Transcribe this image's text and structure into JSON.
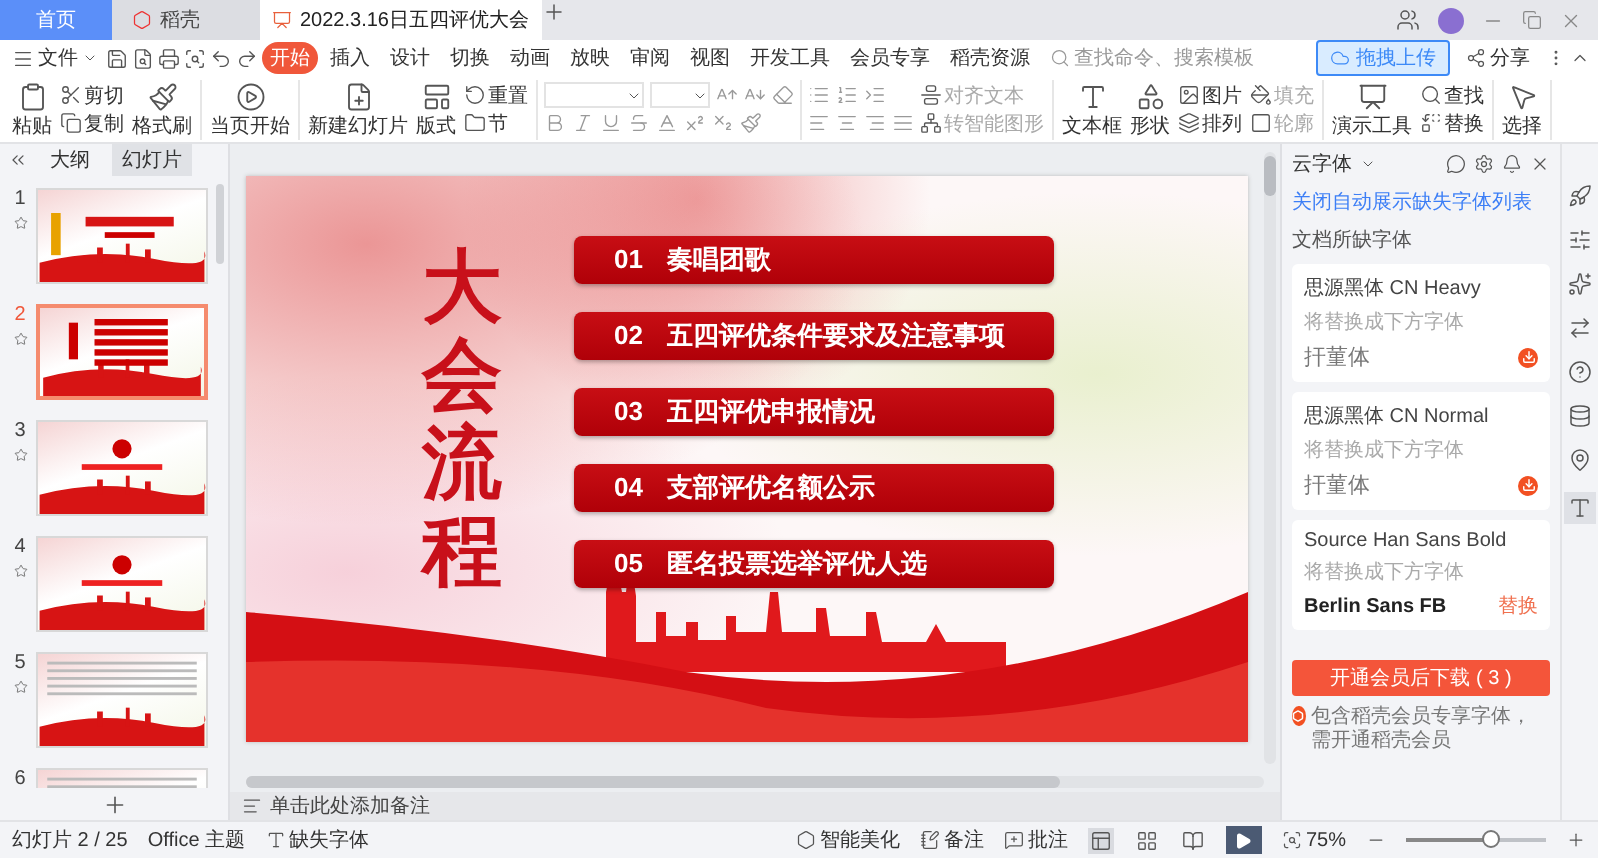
{
  "title_bar": {
    "tabs": [
      {
        "label": "首页",
        "kind": "home",
        "selected": false
      },
      {
        "label": "稻壳",
        "kind": "app",
        "selected": false
      },
      {
        "label": "2022.3.16日五四评优大会",
        "kind": "doc",
        "selected": true
      }
    ]
  },
  "menu": {
    "file": "文件",
    "tabs": [
      {
        "label": "开始",
        "selected": true
      },
      {
        "label": "插入",
        "selected": false
      },
      {
        "label": "设计",
        "selected": false
      },
      {
        "label": "切换",
        "selected": false
      },
      {
        "label": "动画",
        "selected": false
      },
      {
        "label": "放映",
        "selected": false
      },
      {
        "label": "审阅",
        "selected": false
      },
      {
        "label": "视图",
        "selected": false
      },
      {
        "label": "开发工具",
        "selected": false
      },
      {
        "label": "会员专享",
        "selected": false
      },
      {
        "label": "稻壳资源",
        "selected": false
      }
    ],
    "search": {
      "placeholder": "查找命令、搜索模板"
    },
    "upload_button": "拖拽上传",
    "share": "分享"
  },
  "toolbar": [
    {
      "columns": [
        {
          "kind": "large",
          "items": [
            {
              "label": "粘贴",
              "disabled": false
            }
          ]
        },
        {
          "kind": "stack",
          "items": [
            {
              "label": "剪切",
              "disabled": false
            },
            {
              "label": "复制",
              "disabled": false
            }
          ]
        },
        {
          "kind": "large",
          "items": [
            {
              "label": "格式刷",
              "disabled": false
            }
          ]
        }
      ]
    },
    {
      "columns": [
        {
          "kind": "large",
          "items": [
            {
              "label": "当页开始",
              "disabled": false
            }
          ]
        }
      ]
    },
    {
      "columns": [
        {
          "kind": "large",
          "items": [
            {
              "label": "新建幻灯片",
              "disabled": false
            }
          ]
        },
        {
          "kind": "large",
          "items": [
            {
              "label": "版式",
              "disabled": false
            }
          ]
        },
        {
          "kind": "stack",
          "items": [
            {
              "label": "重置",
              "disabled": false
            },
            {
              "label": "节",
              "disabled": false
            }
          ]
        }
      ]
    },
    {
      "columns": [
        {
          "kind": "font"
        }
      ]
    },
    {
      "columns": [
        {
          "kind": "paragraph"
        },
        {
          "kind": "stack",
          "items": [
            {
              "label": "对齐文本",
              "disabled": true
            },
            {
              "label": "转智能图形",
              "disabled": true
            }
          ]
        }
      ]
    },
    {
      "columns": [
        {
          "kind": "large",
          "items": [
            {
              "label": "文本框",
              "disabled": false
            }
          ]
        },
        {
          "kind": "large",
          "items": [
            {
              "label": "形状",
              "disabled": false
            }
          ]
        },
        {
          "kind": "stack",
          "items": [
            {
              "label": "图片",
              "disabled": false
            },
            {
              "label": "排列",
              "disabled": false
            }
          ]
        },
        {
          "kind": "stack",
          "items": [
            {
              "label": "填充",
              "disabled": true
            },
            {
              "label": "轮廓",
              "disabled": true
            }
          ]
        }
      ]
    },
    {
      "columns": [
        {
          "kind": "large",
          "items": [
            {
              "label": "演示工具",
              "disabled": false
            }
          ]
        },
        {
          "kind": "stack",
          "items": [
            {
              "label": "查找",
              "disabled": false
            },
            {
              "label": "替换",
              "disabled": false
            }
          ]
        }
      ]
    },
    {
      "columns": [
        {
          "kind": "large",
          "items": [
            {
              "label": "选择",
              "disabled": false
            }
          ]
        }
      ]
    }
  ],
  "left_panel": {
    "tabs": [
      {
        "label": "大纲",
        "selected": false
      },
      {
        "label": "幻灯片",
        "selected": true
      }
    ],
    "slides": [
      {
        "number": "1",
        "kind": "cover",
        "selected": false
      },
      {
        "number": "2",
        "kind": "agenda",
        "selected": true
      },
      {
        "number": "3",
        "kind": "section",
        "selected": false
      },
      {
        "number": "4",
        "kind": "section",
        "selected": false
      },
      {
        "number": "5",
        "kind": "text",
        "selected": false
      },
      {
        "number": "6",
        "kind": "text",
        "selected": false
      }
    ]
  },
  "slide": {
    "title": "大会流程",
    "items": [
      {
        "number": "01",
        "text": "奏唱团歌"
      },
      {
        "number": "02",
        "text": "五四评优条件要求及注意事项"
      },
      {
        "number": "03",
        "text": "五四评优申报情况"
      },
      {
        "number": "04",
        "text": "支部评优名额公示"
      },
      {
        "number": "05",
        "text": "匿名投票选举评优人选"
      }
    ]
  },
  "notes": {
    "placeholder": "单击此处添加备注"
  },
  "font_panel": {
    "title": "云字体",
    "link": "关闭自动展示缺失字体列表",
    "section": "文档所缺字体",
    "cards": [
      {
        "font": "思源黑体 CN Heavy",
        "hint": "将替换成下方字体",
        "replacement": "扞菫体",
        "action": {
          "kind": "icon"
        }
      },
      {
        "font": "思源黑体 CN Normal",
        "hint": "将替换成下方字体",
        "replacement": "扞菫体",
        "action": {
          "kind": "icon"
        }
      },
      {
        "font": "Source Han Sans Bold",
        "hint": "将替换成下方字体",
        "replacement": "Berlin Sans FB",
        "action": {
          "kind": "text",
          "label": "替换"
        }
      }
    ],
    "download_button": "开通会员后下载 ( 3 )",
    "note": "包含稻壳会员专享字体，需开通稻壳会员"
  },
  "status_bar": {
    "slide_count": "幻灯片 2 / 25",
    "theme": "Office 主题",
    "missing_fonts": "缺失字体",
    "beautify": "智能美化",
    "notes": "备注",
    "comments": "批注",
    "views": [
      {
        "selected": true
      },
      {
        "selected": false
      },
      {
        "selected": false
      }
    ],
    "zoom": "75%",
    "zoom_slider": {
      "level": 0.6
    }
  }
}
